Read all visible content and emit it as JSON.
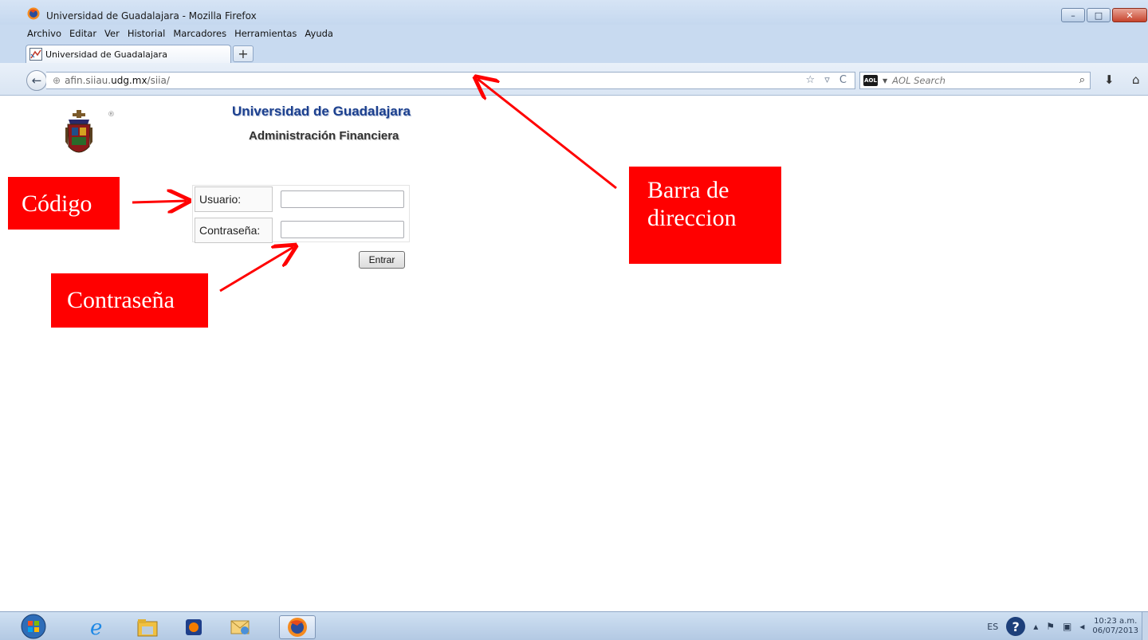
{
  "window": {
    "title": "Universidad de Guadalajara - Mozilla Firefox",
    "controls": {
      "minimize": "–",
      "maximize": "□",
      "close": "✕"
    }
  },
  "menu": {
    "items": [
      "Archivo",
      "Editar",
      "Ver",
      "Historial",
      "Marcadores",
      "Herramientas",
      "Ayuda"
    ]
  },
  "tabs": [
    {
      "label": "Universidad de Guadalajara"
    }
  ],
  "new_tab_label": "+",
  "address_bar": {
    "url_prefix": "afin.siiau.",
    "url_domain": "udg.mx",
    "url_path": "/siia/",
    "icons": "☆ ▿ C"
  },
  "search_bar": {
    "engine_icon": "AOL",
    "placeholder": "AOL Search"
  },
  "page": {
    "title": "Universidad de Guadalajara",
    "subtitle": "Administración Financiera",
    "registered_mark": "®",
    "login": {
      "user_label": "Usuario:",
      "password_label": "Contraseña:",
      "user_value": "",
      "password_value": "",
      "submit_label": "Entrar"
    }
  },
  "annotations": {
    "codigo": "Código",
    "contrasena": "Contraseña",
    "barra_line1": "Barra de",
    "barra_line2": "direccion",
    "color": "#ff0000"
  },
  "taskbar": {
    "apps": [
      "windows-start",
      "internet-explorer",
      "file-explorer",
      "media-app",
      "mail-app",
      "firefox"
    ],
    "tray": {
      "language": "ES",
      "time": "10:23 a.m.",
      "date": "06/07/2013"
    }
  }
}
